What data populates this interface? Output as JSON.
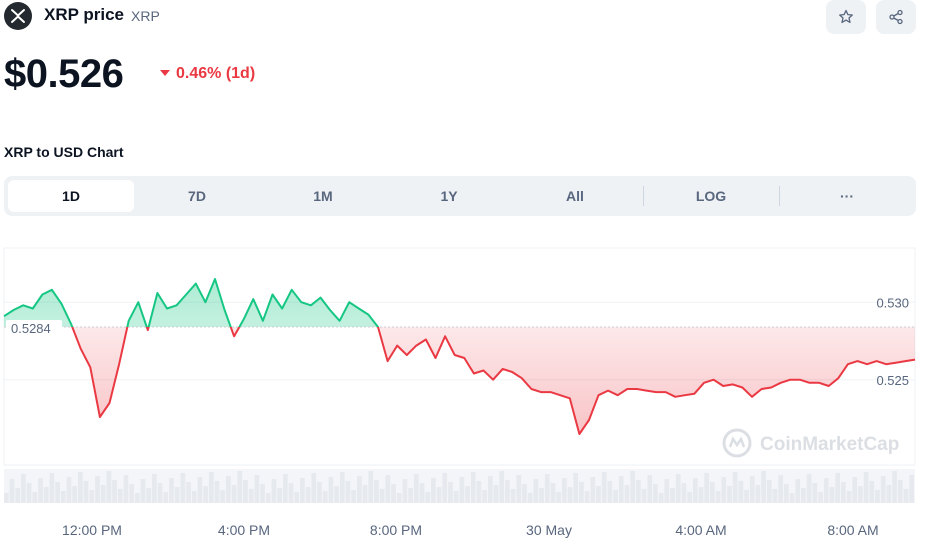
{
  "header": {
    "name": "XRP price",
    "symbol": "XRP"
  },
  "price": {
    "value": "$0.526",
    "change": "0.46% (1d)"
  },
  "chart_title": "XRP to USD Chart",
  "tabs": [
    "1D",
    "7D",
    "1M",
    "1Y",
    "All",
    "LOG",
    "···"
  ],
  "active_tab": "1D",
  "colors": {
    "up": "#16c784",
    "down": "#ea3943",
    "up_fill": "#d8f5e9",
    "down_fill": "#fbe1e3"
  },
  "chart_data": {
    "type": "area",
    "baseline_label": "0.5284",
    "baseline": 0.5284,
    "watermark": "CoinMarketCap",
    "x_ticks": [
      "12:00 PM",
      "4:00 PM",
      "8:00 PM",
      "30 May",
      "4:00 AM",
      "8:00 AM"
    ],
    "y_ticks": [
      0.53,
      0.525
    ],
    "y_tick_labels": [
      "0.530",
      "0.525"
    ],
    "ylim": [
      0.5195,
      0.5335
    ],
    "x": [
      "10:15",
      "10:30",
      "10:45",
      "11:00",
      "11:15",
      "11:30",
      "11:45",
      "12:00",
      "12:15",
      "12:30",
      "12:45",
      "13:00",
      "13:15",
      "13:30",
      "13:45",
      "14:00",
      "14:15",
      "14:30",
      "14:45",
      "15:00",
      "15:15",
      "15:30",
      "15:45",
      "16:00",
      "16:15",
      "16:30",
      "16:45",
      "17:00",
      "17:15",
      "17:30",
      "17:45",
      "18:00",
      "18:15",
      "18:30",
      "18:45",
      "19:00",
      "19:15",
      "19:30",
      "19:45",
      "20:00",
      "20:15",
      "20:30",
      "20:45",
      "21:00",
      "21:15",
      "21:30",
      "21:45",
      "22:00",
      "22:15",
      "22:30",
      "22:45",
      "23:00",
      "23:15",
      "23:30",
      "23:45",
      "00:00",
      "00:15",
      "00:30",
      "00:45",
      "01:00",
      "01:15",
      "01:30",
      "01:45",
      "02:00",
      "02:15",
      "02:30",
      "02:45",
      "03:00",
      "03:15",
      "03:30",
      "03:45",
      "04:00",
      "04:15",
      "04:30",
      "04:45",
      "05:00",
      "05:15",
      "05:30",
      "05:45",
      "06:00",
      "06:15",
      "06:30",
      "06:45",
      "07:00",
      "07:15",
      "07:30",
      "07:45",
      "08:00",
      "08:15",
      "08:30",
      "08:45",
      "09:00",
      "09:15",
      "09:30",
      "09:45",
      "10:00"
    ],
    "values": [
      0.5291,
      0.5295,
      0.5298,
      0.5296,
      0.5305,
      0.5308,
      0.5299,
      0.5286,
      0.527,
      0.5258,
      0.5226,
      0.5235,
      0.526,
      0.5288,
      0.53,
      0.5282,
      0.5306,
      0.5296,
      0.5298,
      0.5305,
      0.5312,
      0.53,
      0.5315,
      0.5295,
      0.5278,
      0.5289,
      0.5302,
      0.5288,
      0.5305,
      0.5296,
      0.5308,
      0.53,
      0.5298,
      0.5303,
      0.5295,
      0.5288,
      0.53,
      0.5296,
      0.5292,
      0.5284,
      0.5262,
      0.5272,
      0.5266,
      0.5272,
      0.5276,
      0.5264,
      0.5278,
      0.5266,
      0.5264,
      0.5254,
      0.5256,
      0.525,
      0.5257,
      0.5255,
      0.5251,
      0.5244,
      0.5242,
      0.5242,
      0.524,
      0.5238,
      0.5215,
      0.5224,
      0.524,
      0.5243,
      0.524,
      0.5244,
      0.5244,
      0.5243,
      0.5242,
      0.5242,
      0.5239,
      0.524,
      0.5241,
      0.5248,
      0.525,
      0.5246,
      0.5247,
      0.5245,
      0.5239,
      0.5244,
      0.5245,
      0.5248,
      0.525,
      0.525,
      0.5248,
      0.5248,
      0.5246,
      0.5251,
      0.526,
      0.5262,
      0.526,
      0.5262,
      0.526,
      0.5261,
      0.5262,
      0.5263
    ]
  }
}
